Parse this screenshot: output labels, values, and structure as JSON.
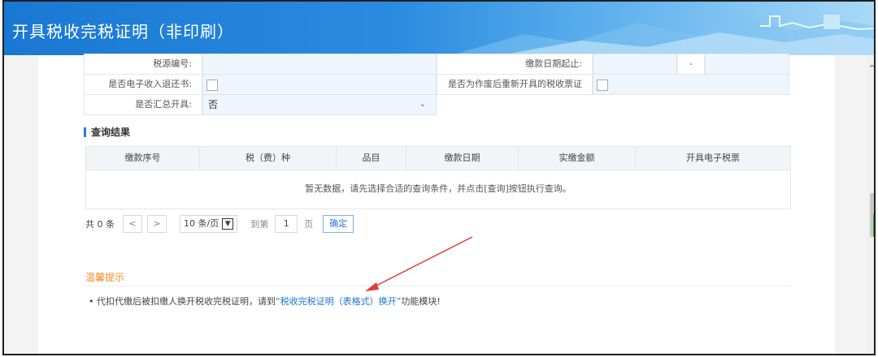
{
  "header": {
    "title": "开具税收完税证明（非印刷）"
  },
  "form": {
    "row1": {
      "label_left": "税源编号:",
      "value_left": "",
      "label_right": "缴款日期起止:",
      "date_sep": "-"
    },
    "row2": {
      "label_left": "是否电子收入退还书:",
      "label_right": "是否为作废后重新开具的税收票证"
    },
    "row3": {
      "label_left": "是否汇总开具:",
      "value_left": "否"
    }
  },
  "results": {
    "section_title": "查询结果",
    "columns": [
      "缴款序号",
      "税（费）种",
      "品目",
      "缴款日期",
      "实缴金额",
      "开具电子税票"
    ],
    "empty_message": "暂无数据，请先选择合适的查询条件，并点击[查询]按钮执行查询。"
  },
  "pager": {
    "total": "共 0 条",
    "prev": "<",
    "next": ">",
    "page_size": "10 条/页",
    "goto_label": "到第",
    "page_value": "1",
    "page_unit": "页",
    "confirm": "确定"
  },
  "tips": {
    "title": "温馨提示",
    "line_prefix": "• 代扣代缴后被扣缴人换开税收完税证明，请到",
    "link": "“税收完税证明（表格式）换开”",
    "line_suffix": "功能模块!"
  },
  "colors": {
    "header_blue": "#1a78d2",
    "link_blue": "#1c74d0",
    "tips_orange": "#f08a1c",
    "annotation_arrow": "#e23a3a"
  }
}
